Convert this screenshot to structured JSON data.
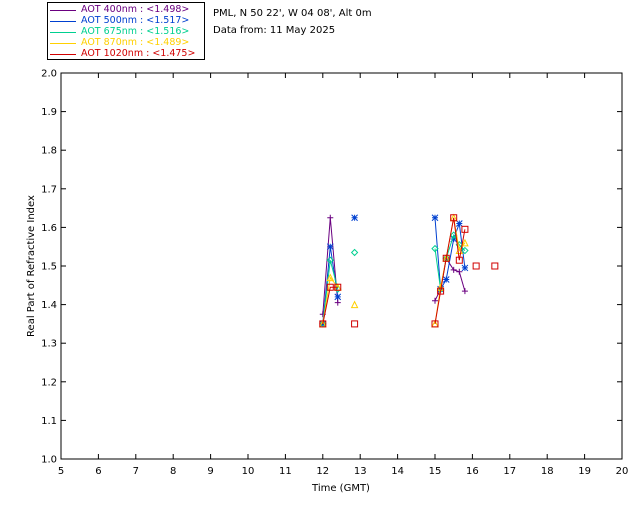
{
  "header": {
    "site": "PML, N 50 22', W 04 08', Alt 0m",
    "date": "Data from: 11 May 2025"
  },
  "legend": [
    {
      "label": "AOT  400nm : <1.498>",
      "color": "#6a0080"
    },
    {
      "label": "AOT  500nm : <1.517>",
      "color": "#0040d0"
    },
    {
      "label": "AOT  675nm : <1.516>",
      "color": "#00d090"
    },
    {
      "label": "AOT  870nm : <1.489>",
      "color": "#ffd000"
    },
    {
      "label": "AOT 1020nm : <1.475>",
      "color": "#d00000"
    }
  ],
  "chart_data": {
    "type": "scatter",
    "title": "",
    "xlabel": "Time (GMT)",
    "ylabel": "Real Part of Refractive Index",
    "xlim": [
      5,
      20
    ],
    "ylim": [
      1.0,
      2.0
    ],
    "xticks": [
      5,
      6,
      7,
      8,
      9,
      10,
      11,
      12,
      13,
      14,
      15,
      16,
      17,
      18,
      19,
      20
    ],
    "yticks": [
      1.0,
      1.1,
      1.2,
      1.3,
      1.4,
      1.5,
      1.6,
      1.7,
      1.8,
      1.9,
      2.0
    ],
    "grid": false,
    "series": [
      {
        "name": "AOT  400nm",
        "color": "#6a0080",
        "marker": "plus",
        "segments": [
          [
            [
              12.0,
              1.375
            ],
            [
              12.2,
              1.625
            ],
            [
              12.4,
              1.405
            ]
          ],
          [
            [
              15.0,
              1.41
            ],
            [
              15.15,
              1.44
            ],
            [
              15.3,
              1.52
            ],
            [
              15.5,
              1.49
            ],
            [
              15.65,
              1.485
            ],
            [
              15.8,
              1.435
            ]
          ]
        ]
      },
      {
        "name": "AOT  500nm",
        "color": "#0040d0",
        "marker": "star",
        "segments": [
          [
            [
              12.0,
              1.35
            ],
            [
              12.2,
              1.55
            ],
            [
              12.4,
              1.42
            ]
          ],
          [
            [
              12.85,
              1.625
            ]
          ],
          [
            [
              15.0,
              1.625
            ],
            [
              15.15,
              1.44
            ],
            [
              15.3,
              1.465
            ],
            [
              15.5,
              1.57
            ],
            [
              15.65,
              1.61
            ],
            [
              15.8,
              1.495
            ]
          ]
        ]
      },
      {
        "name": "AOT  675nm",
        "color": "#00d090",
        "marker": "diamond",
        "segments": [
          [
            [
              12.0,
              1.35
            ],
            [
              12.2,
              1.515
            ],
            [
              12.4,
              1.44
            ]
          ],
          [
            [
              12.85,
              1.535
            ]
          ],
          [
            [
              15.0,
              1.545
            ],
            [
              15.15,
              1.44
            ],
            [
              15.3,
              1.52
            ],
            [
              15.5,
              1.58
            ],
            [
              15.65,
              1.555
            ],
            [
              15.8,
              1.54
            ]
          ]
        ]
      },
      {
        "name": "AOT  870nm",
        "color": "#ffd000",
        "marker": "triangle",
        "segments": [
          [
            [
              12.0,
              1.35
            ],
            [
              12.2,
              1.47
            ],
            [
              12.4,
              1.445
            ]
          ],
          [
            [
              12.85,
              1.4
            ]
          ],
          [
            [
              15.0,
              1.35
            ],
            [
              15.15,
              1.445
            ],
            [
              15.3,
              1.52
            ],
            [
              15.5,
              1.625
            ],
            [
              15.65,
              1.54
            ],
            [
              15.8,
              1.56
            ]
          ]
        ]
      },
      {
        "name": "AOT 1020nm",
        "color": "#d00000",
        "marker": "square",
        "segments": [
          [
            [
              12.0,
              1.35
            ],
            [
              12.2,
              1.445
            ],
            [
              12.4,
              1.445
            ]
          ],
          [
            [
              12.85,
              1.35
            ]
          ],
          [
            [
              15.0,
              1.35
            ],
            [
              15.15,
              1.435
            ],
            [
              15.3,
              1.52
            ],
            [
              15.5,
              1.625
            ],
            [
              15.65,
              1.515
            ],
            [
              15.8,
              1.595
            ]
          ],
          [
            [
              16.1,
              1.5
            ]
          ],
          [
            [
              16.6,
              1.5
            ]
          ]
        ]
      }
    ]
  }
}
